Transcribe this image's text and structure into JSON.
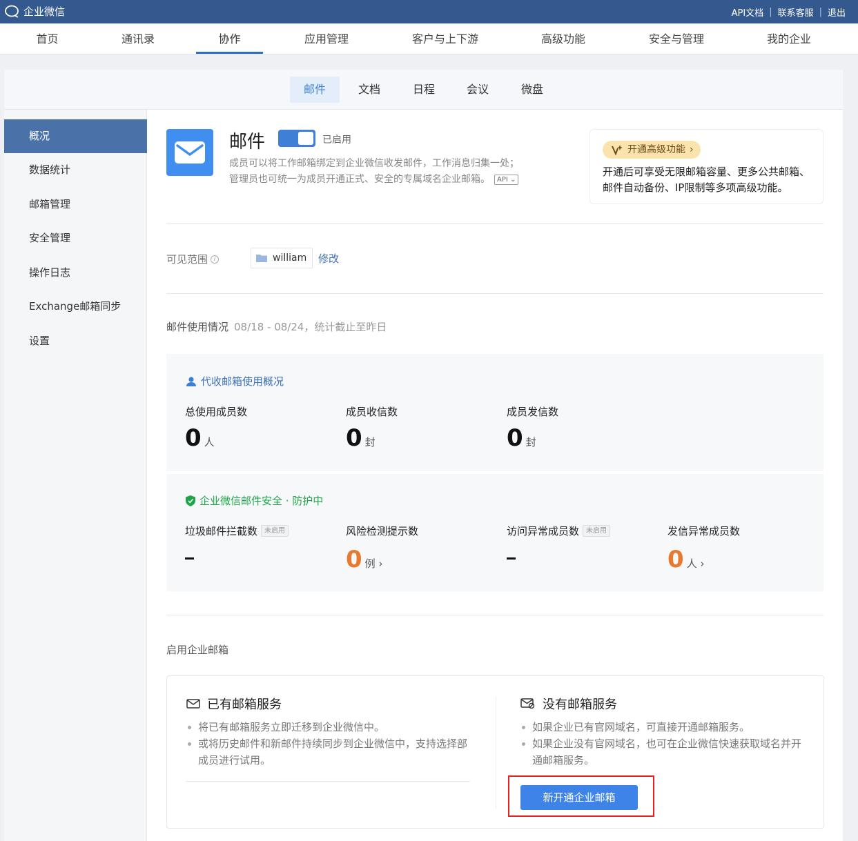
{
  "header": {
    "logo_text": "企业微信",
    "links": [
      "API文档",
      "联系客服",
      "退出"
    ]
  },
  "main_nav": {
    "items": [
      "首页",
      "通讯录",
      "协作",
      "应用管理",
      "客户与上下游",
      "高级功能",
      "安全与管理",
      "我的企业"
    ],
    "active": "协作"
  },
  "sub_tabs": {
    "items": [
      "邮件",
      "文档",
      "日程",
      "会议",
      "微盘"
    ],
    "active": "邮件"
  },
  "sidebar": {
    "items": [
      "概况",
      "数据统计",
      "邮箱管理",
      "安全管理",
      "操作日志",
      "Exchange邮箱同步",
      "设置"
    ],
    "active": "概况"
  },
  "app": {
    "title": "邮件",
    "status_label": "已启用",
    "enabled": true,
    "description_line1": "成员可以将工作邮箱绑定到企业微信收发邮件，工作消息归集一处；",
    "description_line2": "管理员也可统一为成员开通正式、安全的专属域名企业邮箱。",
    "api_badge": "API"
  },
  "promo": {
    "button": "开通高级功能",
    "text": "开通后可享受无限邮箱容量、更多公共邮箱、邮件自动备份、IP限制等多项高级功能。"
  },
  "scope": {
    "label": "可见范围",
    "member": "william",
    "edit": "修改"
  },
  "usage": {
    "title": "邮件使用情况",
    "range": "08/18 - 08/24，统计截止至昨日"
  },
  "proxy_panel": {
    "title": "代收邮箱使用概况",
    "stats": [
      {
        "label": "总使用成员数",
        "value": "0",
        "unit": "人"
      },
      {
        "label": "成员收信数",
        "value": "0",
        "unit": "封"
      },
      {
        "label": "成员发信数",
        "value": "0",
        "unit": "封"
      }
    ]
  },
  "security_panel": {
    "title": "企业微信邮件安全 · 防护中",
    "stats": [
      {
        "label": "垃圾邮件拦截数",
        "badge": "未启用",
        "value": "–"
      },
      {
        "label": "风险检测提示数",
        "value": "0",
        "unit": "例"
      },
      {
        "label": "访问异常成员数",
        "badge": "未启用",
        "value": "–"
      },
      {
        "label": "发信异常成员数",
        "value": "0",
        "unit": "人"
      }
    ]
  },
  "enable": {
    "title": "启用企业邮箱",
    "existing": {
      "title": "已有邮箱服务",
      "bullets": [
        "将已有邮箱服务立即迁移到企业微信中。",
        "或将历史邮件和新邮件持续同步到企业微信中，支持选择部成员进行试用。"
      ]
    },
    "none": {
      "title": "没有邮箱服务",
      "bullets": [
        "如果企业已有官网域名，可直接开通邮箱服务。",
        "如果企业没有官网域名，也可在企业微信快速获取域名并开通邮箱服务。"
      ],
      "button": "新开通企业邮箱"
    }
  },
  "colors": {
    "topbar": "#34598f",
    "accent": "#3d83e8",
    "highlight": "#e8201e",
    "orange": "#e8792e",
    "green": "#1fa649"
  }
}
